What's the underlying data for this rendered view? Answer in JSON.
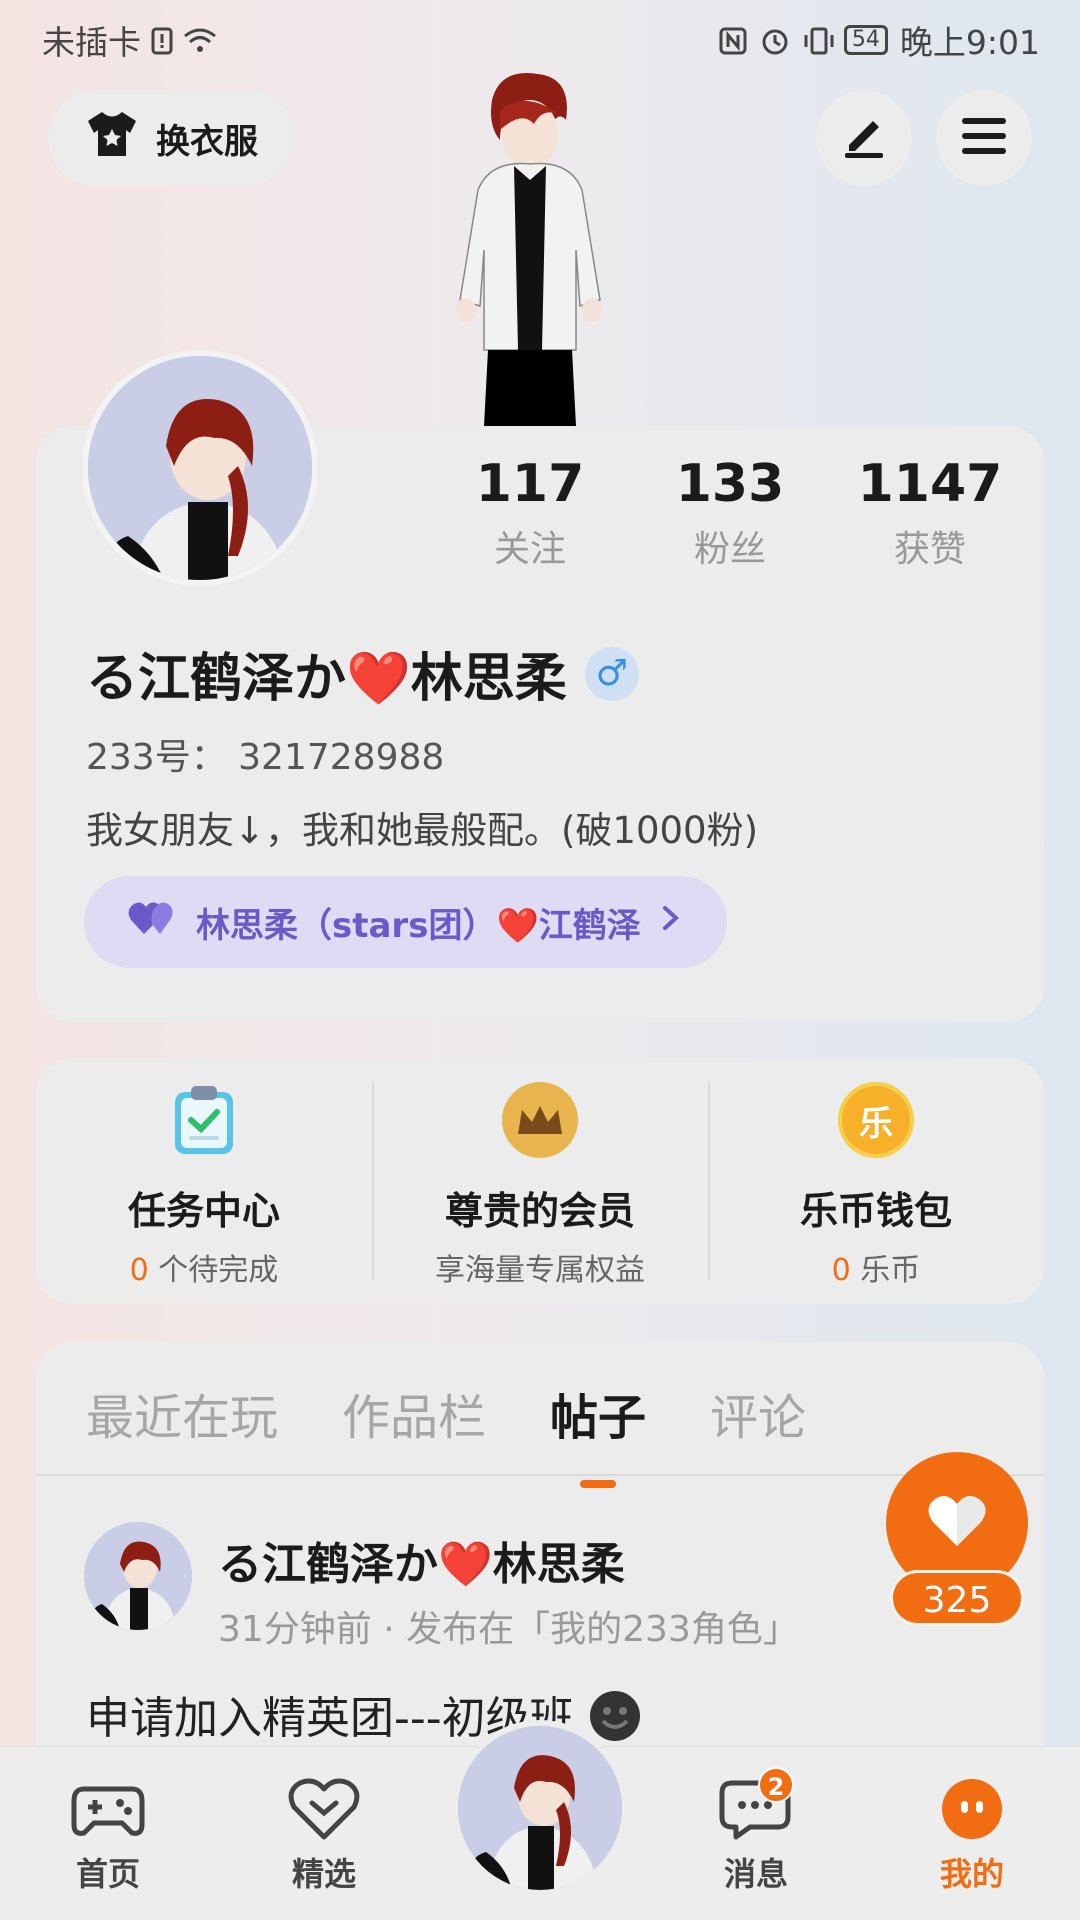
{
  "status_bar": {
    "carrier": "未插卡",
    "battery": "54",
    "time": "晚上9:01"
  },
  "header": {
    "dress_button": "换衣服"
  },
  "profile": {
    "stats": [
      {
        "value": "117",
        "label": "关注"
      },
      {
        "value": "133",
        "label": "粉丝"
      },
      {
        "value": "1147",
        "label": "获赞"
      }
    ],
    "username": "る江鹤泽か❤️林思柔",
    "gender_symbol": "♂",
    "uid": "233号： 321728988",
    "bio": "我女朋友↓，我和她最般配。(破1000粉)",
    "relation": "林思柔（stars团）❤️江鹤泽"
  },
  "features": [
    {
      "title": "任务中心",
      "sub_value": "0",
      "sub_text": " 个待完成"
    },
    {
      "title": "尊贵的会员",
      "sub_value": "",
      "sub_text": "享海量专属权益"
    },
    {
      "title": "乐币钱包",
      "sub_value": "0",
      "sub_text": " 乐币",
      "icon_text": "乐"
    }
  ],
  "tabs": [
    "最近在玩",
    "作品栏",
    "帖子",
    "评论"
  ],
  "active_tab": "帖子",
  "post": {
    "author": "る江鹤泽か❤️林思柔",
    "meta": "31分钟前 · 发布在「我的233角色」",
    "text": "申请加入精英团---初级班"
  },
  "like": {
    "count": "325"
  },
  "bottom_nav": {
    "items": [
      "首页",
      "精选",
      "消息",
      "我的"
    ],
    "message_badge": "2"
  },
  "colors": {
    "accent": "#f26d12",
    "relation_text": "#6b58c9"
  }
}
